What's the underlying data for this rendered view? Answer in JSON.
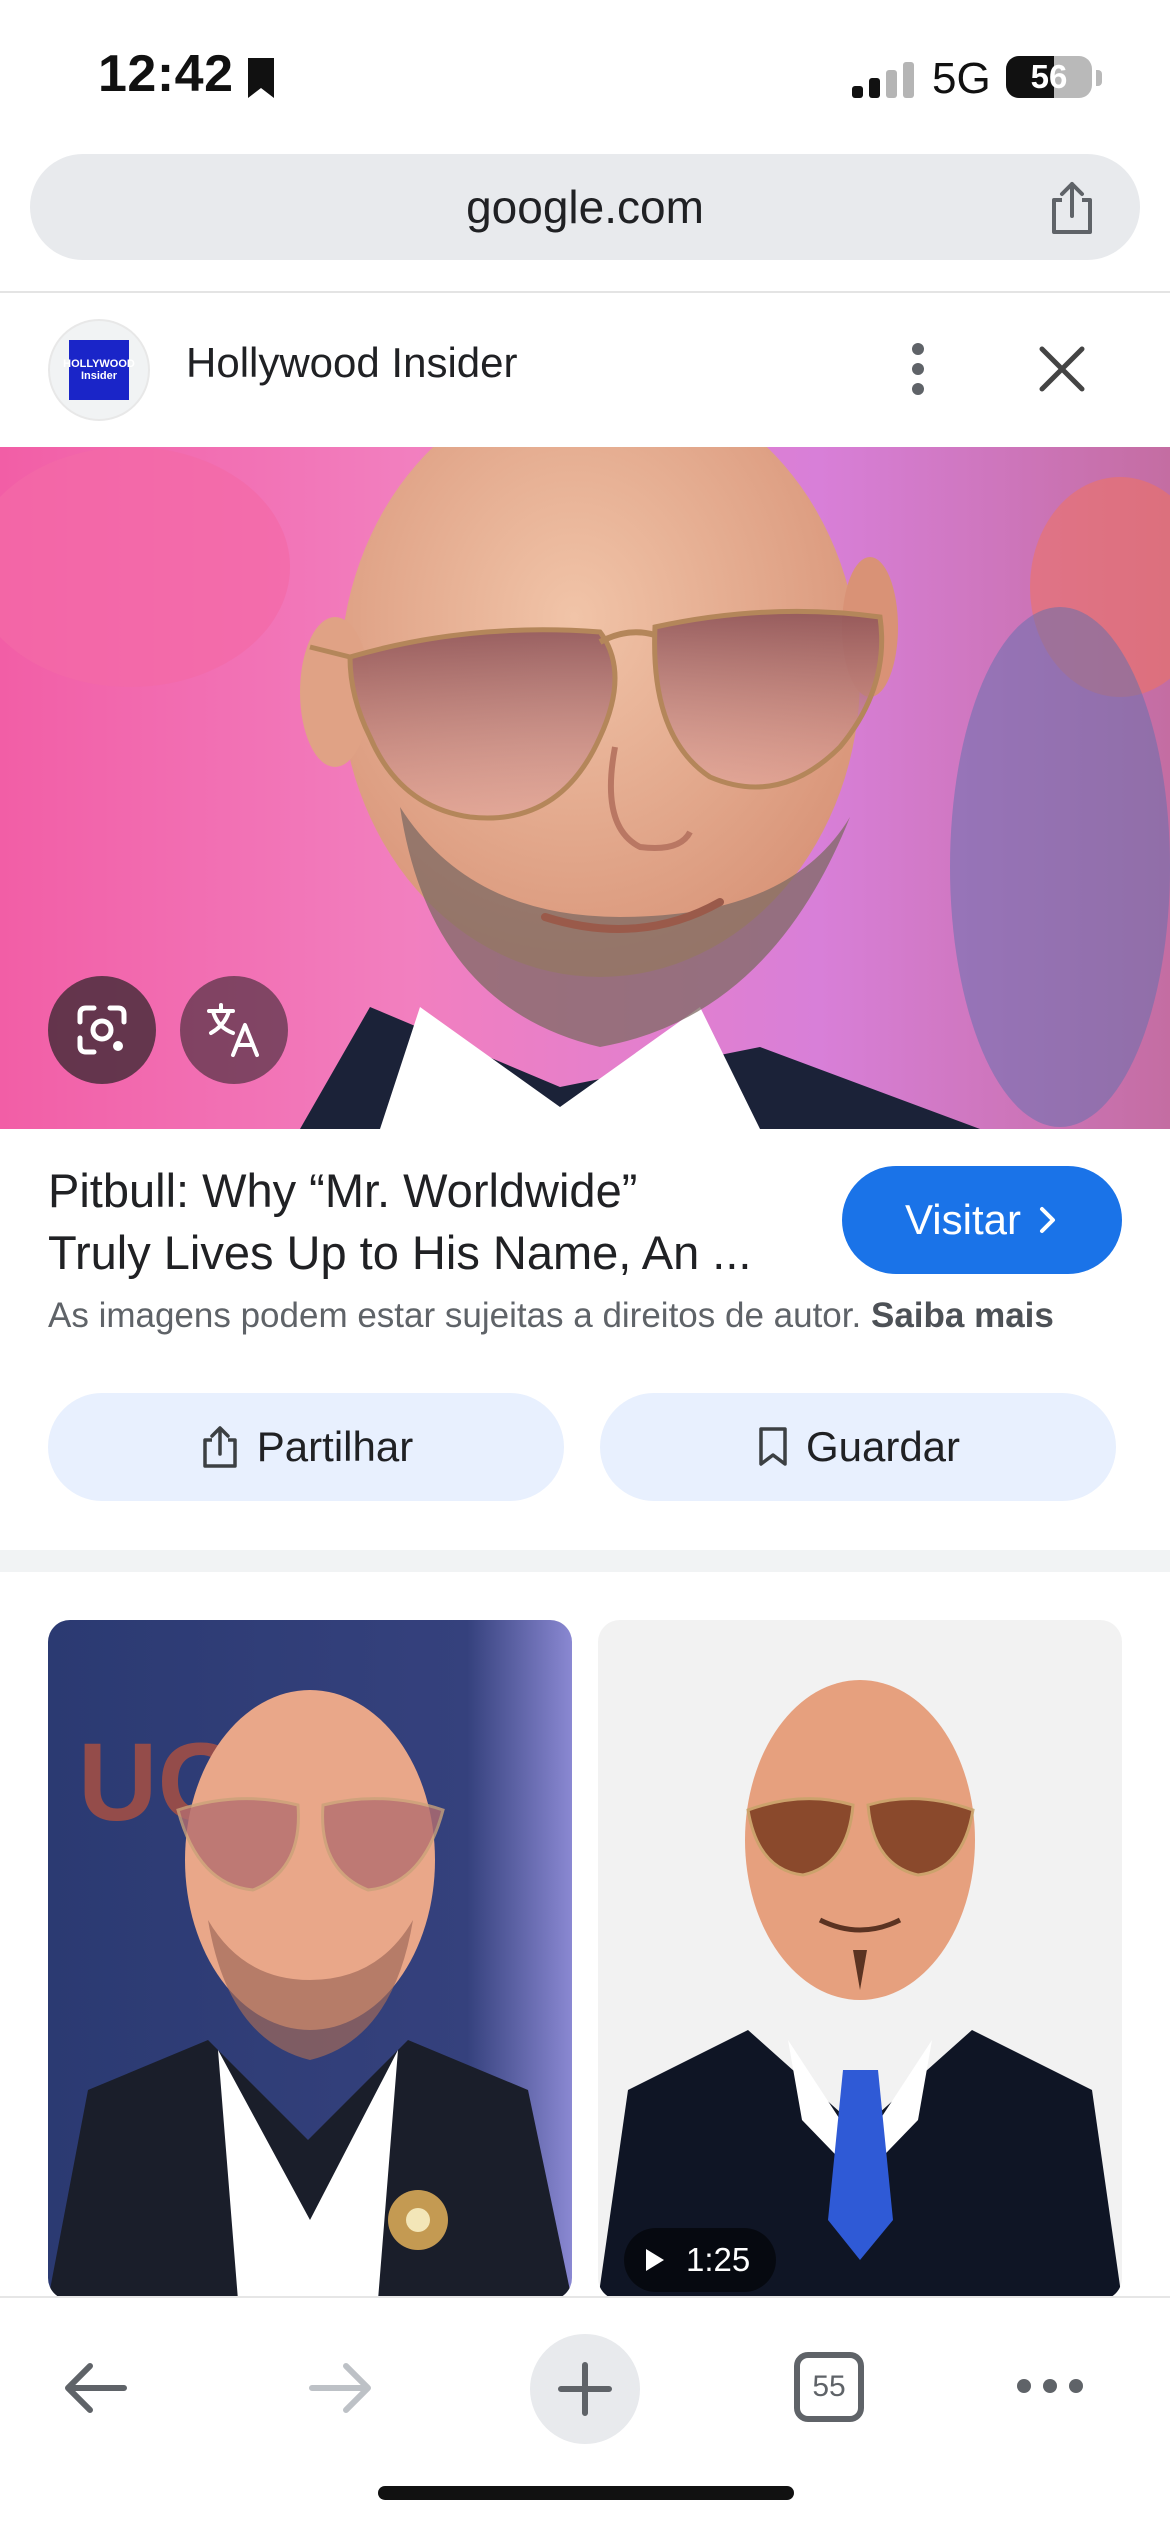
{
  "status_bar": {
    "time": "12:42",
    "network": "5G",
    "battery_level": "56",
    "battery_fraction": 0.56
  },
  "browser": {
    "url": "google.com"
  },
  "source": {
    "name": "Hollywood Insider",
    "logo_text": "HOLLYWOOD Insider"
  },
  "result": {
    "title_line1": "Pitbull: Why “Mr. Worldwide”",
    "title_line2": "Truly Lives Up to His Name, An ...",
    "visit_label": "Visitar",
    "copyright_text": "As imagens podem estar sujeitas a direitos de autor.",
    "learn_more": "Saiba mais",
    "share_label": "Partilhar",
    "save_label": "Guardar"
  },
  "related": {
    "video_duration": "1:25"
  },
  "toolbar": {
    "tab_count": "55"
  },
  "icons": {
    "status_bookmark": "bookmark-icon",
    "url_share": "share-icon",
    "more": "more-vertical-icon",
    "close": "close-icon",
    "lens": "google-lens-icon",
    "translate": "translate-icon",
    "chevron": "chevron-right-icon",
    "share": "share-icon",
    "save": "bookmark-icon",
    "play": "play-icon",
    "back": "arrow-back-icon",
    "forward": "arrow-forward-icon",
    "new_tab": "plus-icon",
    "tabs": "tabs-icon",
    "menu": "more-horizontal-icon"
  },
  "colors": {
    "accent": "#1a73e8",
    "chip_background": "#e8f0fe",
    "url_bar": "#e8eaed"
  }
}
